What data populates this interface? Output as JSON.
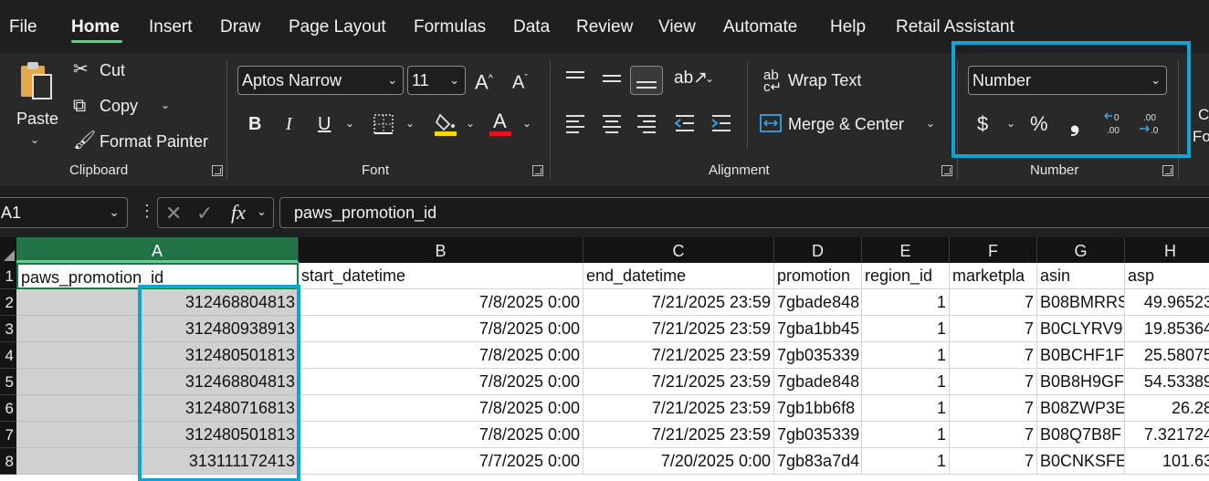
{
  "menu": {
    "tabs": [
      "File",
      "Home",
      "Insert",
      "Draw",
      "Page Layout",
      "Formulas",
      "Data",
      "Review",
      "View",
      "Automate",
      "Help",
      "Retail Assistant"
    ],
    "active": "Home"
  },
  "clipboard": {
    "paste": "Paste",
    "cut": "Cut",
    "copy": "Copy",
    "format_painter": "Format Painter",
    "label": "Clipboard"
  },
  "font": {
    "family": "Aptos Narrow",
    "size": "11",
    "bold": "B",
    "italic": "I",
    "underline": "U",
    "font_color_glyph": "A",
    "label": "Font",
    "fill_color": "#ffd700",
    "font_color": "#e81123"
  },
  "alignment": {
    "wrap_text": "Wrap Text",
    "merge_center": "Merge & Center",
    "label": "Alignment"
  },
  "number": {
    "format": "Number",
    "currency": "$",
    "percent": "%",
    "comma": "❟",
    "label": "Number"
  },
  "next_group_partial": {
    "line1": "C",
    "line2": "Fo"
  },
  "formula_bar": {
    "name_box": "A1",
    "fx": "fx",
    "content": "paws_promotion_id"
  },
  "grid": {
    "columns": [
      "A",
      "B",
      "C",
      "D",
      "E",
      "F",
      "G",
      "H"
    ],
    "selected_column": "A",
    "row_numbers": [
      "1",
      "2",
      "3",
      "4",
      "5",
      "6",
      "7",
      "8"
    ],
    "headers": [
      "paws_promotion_id",
      "start_datetime",
      "end_datetime",
      "promotion",
      "region_id",
      "marketpla",
      "asin",
      "asp"
    ],
    "rows": [
      [
        "312468804813",
        "7/8/2025 0:00",
        "7/21/2025 23:59",
        "7gbade848",
        "1",
        "7",
        "B08BMRRS",
        "49.96523"
      ],
      [
        "312480938913",
        "7/8/2025 0:00",
        "7/21/2025 23:59",
        "7gba1bb45",
        "1",
        "7",
        "B0CLYRV9",
        "19.85364"
      ],
      [
        "312480501813",
        "7/8/2025 0:00",
        "7/21/2025 23:59",
        "7gb035339",
        "1",
        "7",
        "B0BCHF1F",
        "25.58075"
      ],
      [
        "312468804813",
        "7/8/2025 0:00",
        "7/21/2025 23:59",
        "7gbade848",
        "1",
        "7",
        "B0B8H9GF",
        "54.53389"
      ],
      [
        "312480716813",
        "7/8/2025 0:00",
        "7/21/2025 23:59",
        "7gb1bb6f8",
        "1",
        "7",
        "B08ZWP3E",
        "26.28"
      ],
      [
        "312480501813",
        "7/8/2025 0:00",
        "7/21/2025 23:59",
        "7gb035339",
        "1",
        "7",
        "B08Q7B8F",
        "7.321724"
      ],
      [
        "313111172413",
        "7/7/2025 0:00",
        "7/20/2025 0:00",
        "7gb83a7d4",
        "1",
        "7",
        "B0CNKSFE",
        "101.63"
      ]
    ],
    "numeric_columns": [
      0,
      1,
      2,
      4,
      5,
      7
    ]
  },
  "colors": {
    "accent_green": "#217346",
    "highlight": "#0ea5d6"
  }
}
